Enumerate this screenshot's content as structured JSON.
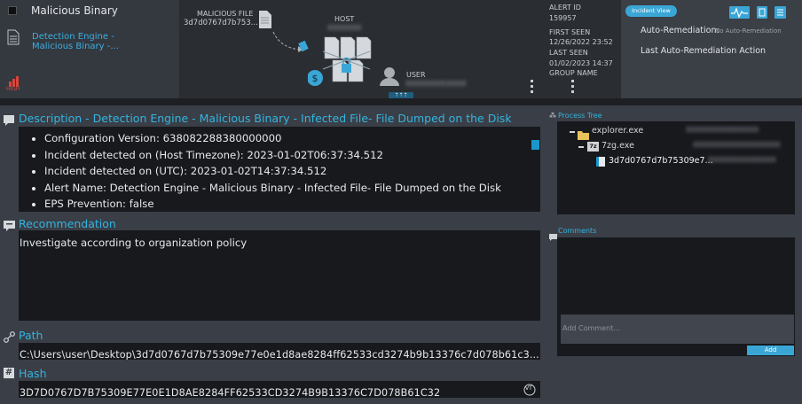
{
  "alert": {
    "title": "Malicious Binary",
    "engine_link": "Detection Engine - Malicious Binary -...",
    "severity": "HIGH"
  },
  "graph": {
    "file_label": "MALICIOUS FILE",
    "file_name": "3d7d0767d7b753...",
    "host_label": "HOST",
    "host_value": "XXXXXXX",
    "user_label": "USER",
    "user_value": "XXXXXXXX\\XXXX",
    "expand_label": "⇡⇡⇡"
  },
  "meta": {
    "alert_id_label": "ALERT ID",
    "alert_id": "159957",
    "first_seen_label": "FIRST SEEN",
    "first_seen": "12/26/2022 23:52",
    "last_seen_label": "LAST SEEN",
    "last_seen": "01/02/2023 14:37",
    "group_label": "GROUP NAME"
  },
  "right_panel": {
    "incident_view": "Incident View",
    "auto_remediation_label": "Auto-Remediation:",
    "auto_remediation_value": "No Auto-Remediation",
    "last_action_label": "Last Auto-Remediation Action"
  },
  "description": {
    "title": "Description - Detection Engine - Malicious Binary - Infected File- File Dumped on the Disk",
    "items": [
      "Configuration Version: 638082288380000000",
      "Incident detected on (Host Timezone): 2023-01-02T06:37:34.512",
      "Incident detected on (UTC): 2023-01-02T14:37:34.512",
      "Alert Name: Detection Engine - Malicious Binary - Infected File- File Dumped on the Disk",
      "EPS Prevention: false"
    ]
  },
  "recommendation": {
    "title": "Recommendation",
    "text": "Investigate according to organization policy"
  },
  "path": {
    "title": "Path",
    "value": "C:\\Users\\user\\Desktop\\3d7d0767d7b75309e77e0e1d8ae8284ff62533cd3274b9b13376c7d078b61c3..."
  },
  "hash": {
    "title": "Hash",
    "value": "3D7D0767D7B75309E77E0E1D8AE8284FF62533CD3274B9B13376C7D078B61C32",
    "vt_label": "VT"
  },
  "process_tree": {
    "title": "Process Tree",
    "nodes": [
      {
        "name": "explorer.exe",
        "user": "XXXXXXXXXXXXXXX"
      },
      {
        "name": "7zg.exe",
        "user": "XXXXXXXXXXXXXXXXXX"
      },
      {
        "name": "3d7d0767d7b75309e7...",
        "user": "XXXXXXXXXXXXXX"
      }
    ]
  },
  "comments": {
    "title": "Comments",
    "placeholder": "Add Comment...",
    "add_label": "Add"
  },
  "colors": {
    "accent": "#33b4e0",
    "severity": "#d9453b",
    "button": "#3aa6d6"
  }
}
